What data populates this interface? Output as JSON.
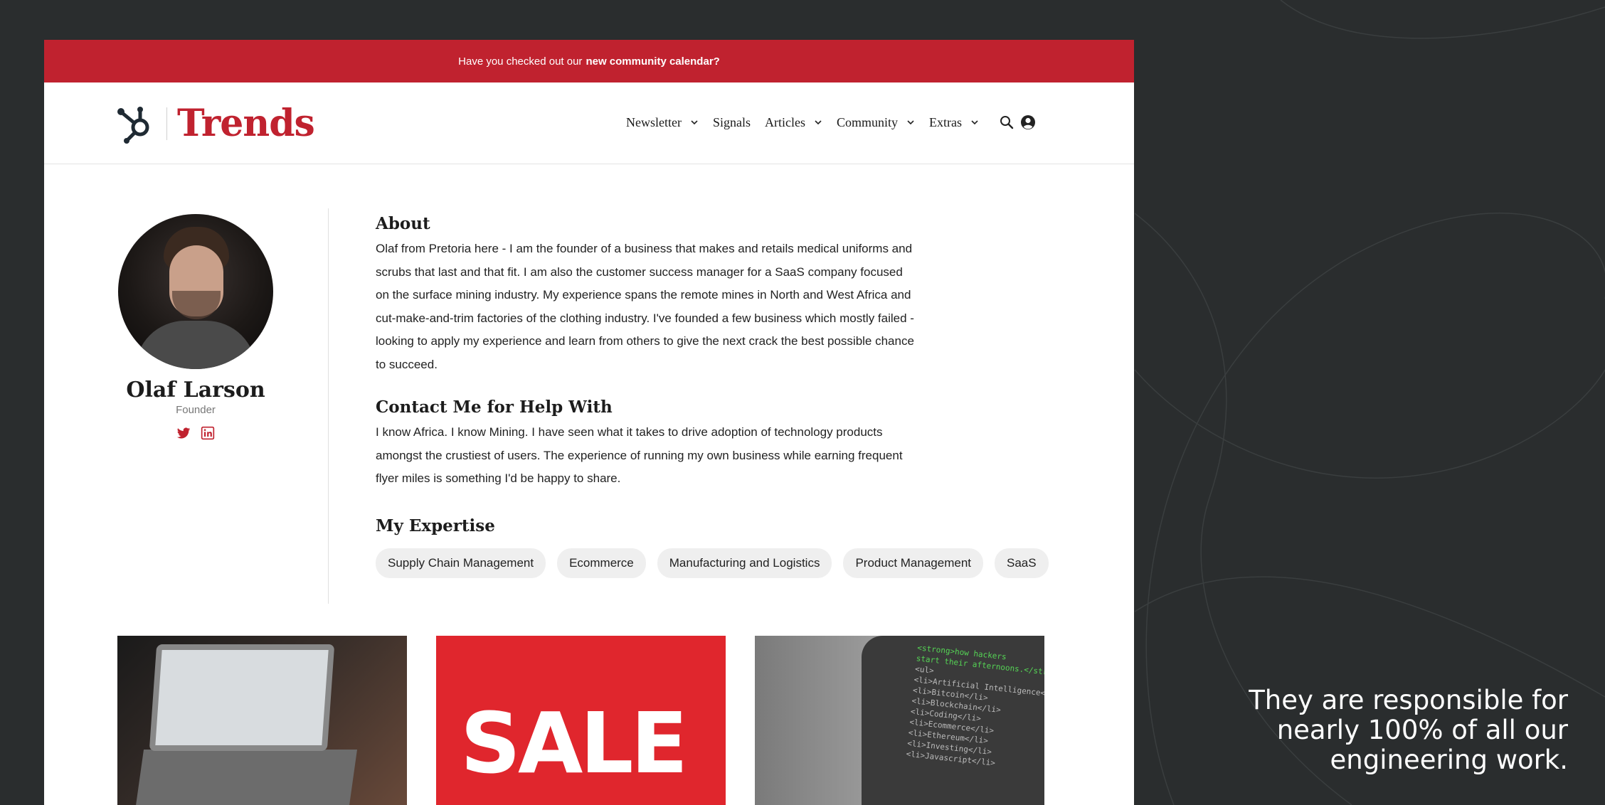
{
  "announcement": {
    "prefix": "Have you checked out our",
    "link": "new community calendar?"
  },
  "brand": {
    "name": "Trends",
    "accent": "#c0222f"
  },
  "nav": {
    "items": [
      {
        "label": "Newsletter",
        "has_dropdown": true
      },
      {
        "label": "Signals",
        "has_dropdown": false
      },
      {
        "label": "Articles",
        "has_dropdown": true
      },
      {
        "label": "Community",
        "has_dropdown": true
      },
      {
        "label": "Extras",
        "has_dropdown": true
      }
    ],
    "icons": [
      "search-icon",
      "account-icon"
    ]
  },
  "profile": {
    "name": "Olaf Larson",
    "role": "Founder",
    "social": [
      "twitter-icon",
      "linkedin-icon"
    ]
  },
  "about": {
    "title": "About",
    "text": "Olaf from Pretoria here - I am the founder of a business that makes and retails medical uniforms and scrubs that last and that fit. I am also the customer success manager for a SaaS company focused on the surface mining industry. My experience spans the remote mines in North and West Africa and cut-make-and-trim factories of the clothing industry. I've founded a few business which mostly failed - looking to apply my experience and learn from others to give the next crack the best possible chance to succeed."
  },
  "contact": {
    "title": "Contact Me for Help With",
    "text": "I know Africa. I know Mining. I have seen what it takes to drive adoption of technology products amongst the crustiest of users. The experience of running my own business while earning frequent flyer miles is something I'd be happy to share."
  },
  "expertise": {
    "title": "My Expertise",
    "tags": [
      "Supply Chain Management",
      "Ecommerce",
      "Manufacturing and Logistics",
      "Product Management",
      "SaaS"
    ]
  },
  "cards": [
    {
      "image": "laptop-photo"
    },
    {
      "image": "sale-sign-photo",
      "text": "SALE"
    },
    {
      "image": "code-shirt-photo",
      "code_lines": [
        "<strong>how hackers",
        "start their afternoons.</strong>",
        "<ul>",
        "<li>Artificial Intelligence</li>",
        "<li>Bitcoin</li>",
        "<li>Blockchain</li>",
        "<li>Coding</li>",
        "<li>Ecommerce</li>",
        "<li>Ethereum</li>",
        "<li>Investing</li>",
        "<li>Javascript</li>"
      ]
    }
  ],
  "caption": "They are responsible for nearly 100% of all our engineering work."
}
